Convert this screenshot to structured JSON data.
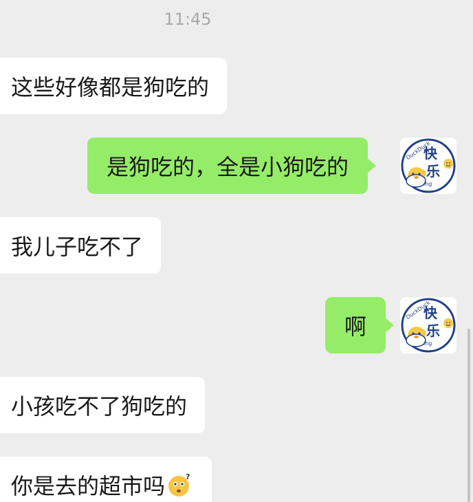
{
  "chat": {
    "timestamp": "11:45",
    "messages": [
      {
        "direction": "incoming",
        "text": "这些好像都是狗吃的"
      },
      {
        "direction": "outgoing",
        "text": "是狗吃的，全是小狗吃的"
      },
      {
        "direction": "incoming",
        "text": "我儿子吃不了"
      },
      {
        "direction": "outgoing",
        "text": "啊"
      },
      {
        "direction": "incoming",
        "text": "小孩吃不了狗吃的"
      },
      {
        "direction": "incoming",
        "text": "你是去的超市吗",
        "emoji": "thinking-face-emoji"
      }
    ],
    "avatar": {
      "icon": "duck-avatar-icon",
      "text_main": "快乐",
      "text_brand": "DuckDuck",
      "text_small": "ing"
    },
    "colors": {
      "background": "#ededed",
      "incoming_bubble": "#ffffff",
      "outgoing_bubble": "#95ec69",
      "timestamp": "#a8a8a8"
    }
  }
}
